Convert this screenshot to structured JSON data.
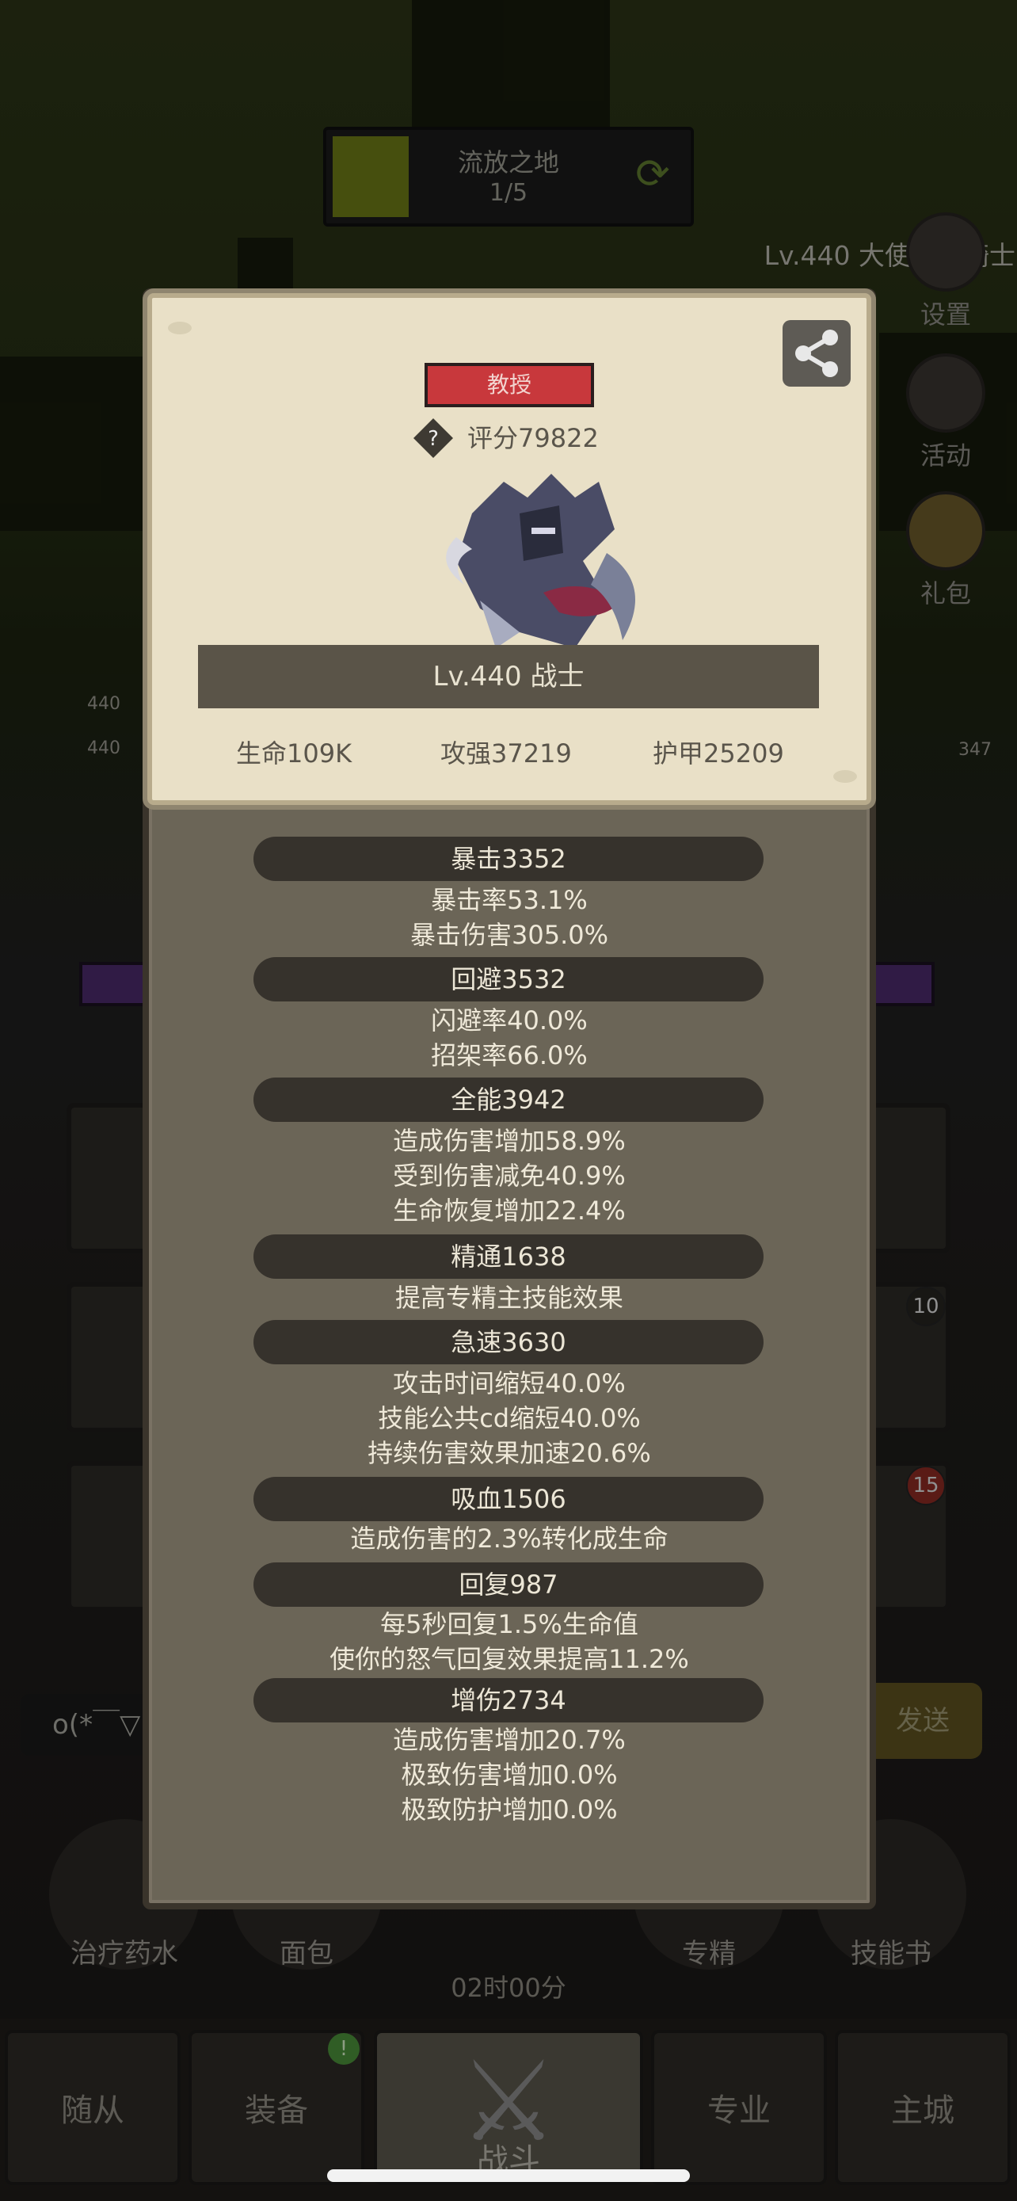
{
  "background": {
    "zone": {
      "name": "流放之地",
      "progress": "1/5"
    },
    "enemy_label": "Lv.440 大使死亡骑士",
    "side_buttons": [
      {
        "label": "设置",
        "icon": "gear-icon"
      },
      {
        "label": "活动",
        "icon": "scroll-icon"
      },
      {
        "label": "礼包",
        "icon": "gift-icon"
      }
    ],
    "ally_levels": [
      "440",
      "440"
    ],
    "enemy_level": "347",
    "slot_badges": [
      "10",
      "15"
    ],
    "chat_text": "o(*￣▽",
    "send_label": "发送",
    "items": [
      {
        "label": "治疗药水",
        "icon": "potion-icon"
      },
      {
        "label": "面包",
        "icon": "bread-icon"
      },
      {
        "label": "专精",
        "icon": "mastery-icon"
      },
      {
        "label": "技能书",
        "icon": "skillbook-icon"
      }
    ],
    "timer": "02时00分",
    "nav": {
      "followers": "随从",
      "equipment": "装备",
      "battle": "战斗",
      "profession": "专业",
      "city": "主城"
    },
    "equipment_badge": "!"
  },
  "dialog": {
    "rank": "教授",
    "score": "评分79822",
    "name": "Lv.440 战士",
    "basic": [
      "生命109K",
      "攻强37219",
      "护甲25209"
    ],
    "stats": [
      {
        "title": "暴击3352",
        "lines": [
          "暴击率53.1%",
          "暴击伤害305.0%"
        ]
      },
      {
        "title": "回避3532",
        "lines": [
          "闪避率40.0%",
          "招架率66.0%"
        ]
      },
      {
        "title": "全能3942",
        "lines": [
          "造成伤害增加58.9%",
          "受到伤害减免40.9%",
          "生命恢复增加22.4%"
        ]
      },
      {
        "title": "精通1638",
        "lines": [
          "提高专精主技能效果"
        ]
      },
      {
        "title": "急速3630",
        "lines": [
          "攻击时间缩短40.0%",
          "技能公共cd缩短40.0%",
          "持续伤害效果加速20.6%"
        ]
      },
      {
        "title": "吸血1506",
        "lines": [
          "造成伤害的2.3%转化成生命"
        ]
      },
      {
        "title": "回复987",
        "lines": [
          "每5秒回复1.5%生命值",
          "使你的怒气回复效果提高11.2%"
        ]
      },
      {
        "title": "增伤2734",
        "lines": [
          "造成伤害增加20.7%",
          "极致伤害增加0.0%",
          "极致防护增加0.0%"
        ]
      }
    ]
  }
}
